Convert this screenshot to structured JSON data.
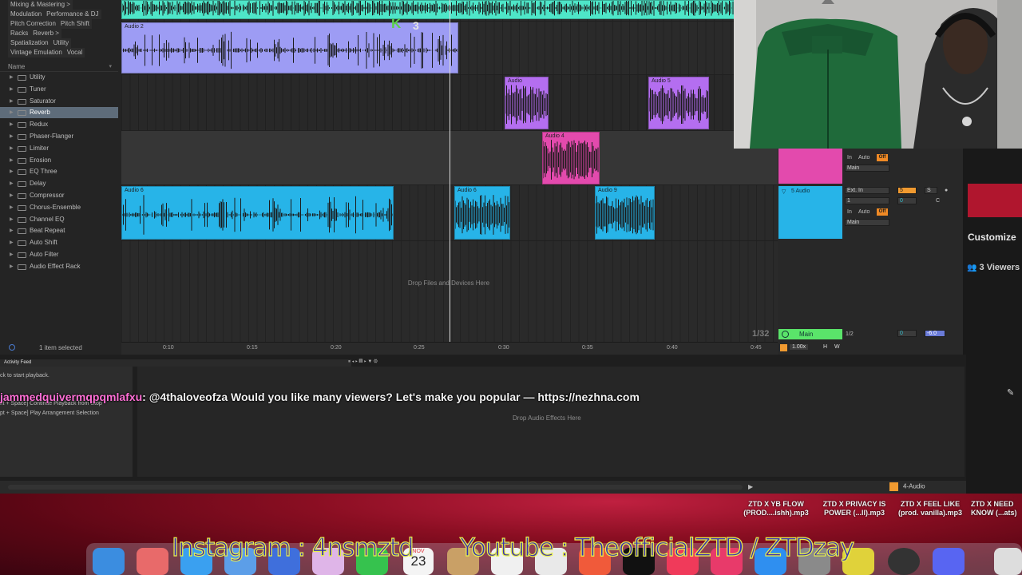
{
  "browser": {
    "tags": [
      [
        "Mixing & Mastering >"
      ],
      [
        "Modulation",
        "Performance & DJ"
      ],
      [
        "Pitch Correction",
        "Pitch Shift"
      ],
      [
        "Racks",
        "Reverb >"
      ],
      [
        "Spatialization",
        "Utility"
      ],
      [
        "Vintage Emulation",
        "Vocal"
      ]
    ],
    "header": "Name",
    "items": [
      "Utility",
      "Tuner",
      "Saturator",
      "Reverb",
      "Redux",
      "Phaser-Flanger",
      "Limiter",
      "Erosion",
      "EQ Three",
      "Delay",
      "Compressor",
      "Chorus-Ensemble",
      "Channel EQ",
      "Beat Repeat",
      "Auto Shift",
      "Auto Filter",
      "Audio Effect Rack"
    ],
    "selected_index": 3,
    "status": "1 item selected"
  },
  "arrangement": {
    "clips": {
      "audio2": "Audio 2",
      "audio": "Audio",
      "audio5": "Audio 5",
      "audio4": "Audio 4",
      "audio6a": "Audio 6",
      "audio6b": "Audio 6",
      "audio9": "Audio 9"
    },
    "drop_files": "Drop Files and Devices Here",
    "loop_label": "3",
    "ruler": [
      "0:10",
      "0:15",
      "0:20",
      "0:25",
      "0:30",
      "0:35",
      "0:40",
      "0:45"
    ],
    "colors": {
      "teal": "#4ee6c8",
      "lavender": "#9d9cf4",
      "purple": "#b46ef0",
      "pink": "#e34aad",
      "blue": "#27b4e8"
    }
  },
  "mixer": {
    "track5_name": "5 Audio",
    "in_label": "In",
    "auto_label": "Auto",
    "off_label": "Off",
    "main_label": "Main",
    "ext_in": "Ext. In",
    "input_ch": "1",
    "track_num": "5",
    "solo": "S",
    "c_label": "C",
    "zero": "0",
    "master_name": "Main",
    "fraction_left": "1/32",
    "fraction": "1/2",
    "master_vol": "-6.0",
    "tempo_scale": "1.00x",
    "h": "H",
    "w": "W"
  },
  "twitch": {
    "customize": "Customize",
    "viewers_count": "3",
    "viewers_label": "Viewers"
  },
  "bottom": {
    "activity_feed": "Activity Feed",
    "info_lines": [
      "ck to start playback.",
      "ift + Space] Continue Playback from Stop",
      "pt + Space] Play Arrangement Selection"
    ],
    "drop_effects": "Drop Audio Effects Here",
    "chat_user": "jammedquivermqpqmlafxu",
    "chat_text": ": @4thaloveofza Would you like many viewers? Let's make you popular — https://nezhna.com",
    "track_label": "4-Audio"
  },
  "desktop": {
    "files": [
      {
        "l1": "ZTD X YB FLOW",
        "l2": "(PROD....ishh).mp3"
      },
      {
        "l1": "ZTD X PRIVACY IS",
        "l2": "POWER (...ll).mp3"
      },
      {
        "l1": "ZTD X FEEL LIKE",
        "l2": "(prod. vanilla).mp3"
      },
      {
        "l1": "ZTD X NEED",
        "l2": "KNOW (...ats)"
      }
    ],
    "overlay_instagram": "Instagram : 4nsmztd",
    "overlay_youtube": "Youtube : TheofficialZTD / ZTDzay",
    "calendar_month": "NOV",
    "calendar_day": "23"
  }
}
